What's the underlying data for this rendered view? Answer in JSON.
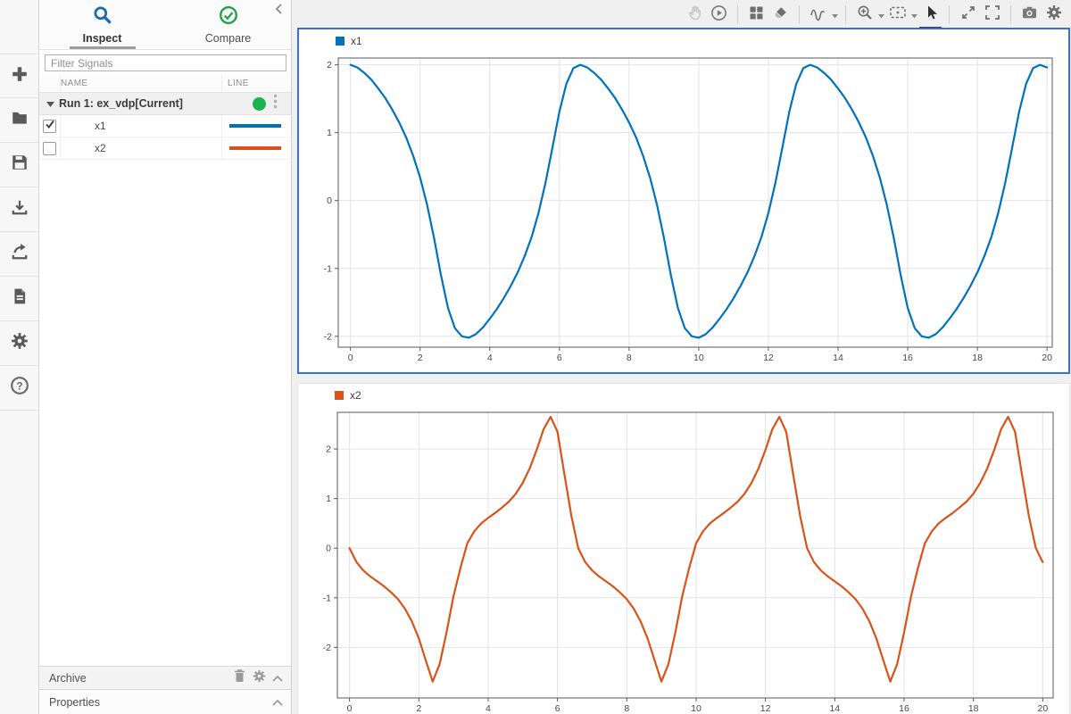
{
  "left_toolbar": {
    "items": [
      "add-icon",
      "open-folder-icon",
      "save-icon",
      "import-icon",
      "export-icon",
      "report-icon",
      "settings-icon",
      "help-icon"
    ]
  },
  "sidebar": {
    "collapse_icon": "chevron-left-icon",
    "tabs": [
      {
        "label": "Inspect",
        "icon": "magnifier-icon",
        "active": true
      },
      {
        "label": "Compare",
        "icon": "check-circle-icon",
        "active": false
      }
    ],
    "filter": {
      "placeholder": "Filter Signals"
    },
    "table": {
      "columns": [
        "NAME",
        "LINE"
      ],
      "run": {
        "label": "Run 1: ex_vdp[Current]",
        "status_color": "#1cb24c",
        "expanded": true,
        "menu_icon": "kebab-menu-icon"
      },
      "signals": [
        {
          "name": "x1",
          "checked": true,
          "color": "#0072BD"
        },
        {
          "name": "x2",
          "checked": false,
          "color": "#D95319"
        }
      ]
    },
    "archive": {
      "label": "Archive",
      "icons": [
        "trash-icon",
        "gear-icon",
        "chevron-up-icon"
      ]
    },
    "properties": {
      "label": "Properties",
      "icons": [
        "chevron-up-icon"
      ]
    }
  },
  "toolbar": {
    "groups": [
      [
        "pan-hand-icon",
        "replay-icon"
      ],
      [
        "layout-grid-icon",
        "eraser-icon"
      ],
      [
        "signal-wave-icon"
      ],
      [
        "zoom-in-icon",
        "zoom-fit-icon",
        "arrow-cursor-icon"
      ],
      [
        "expand-diagonal-icon",
        "fit-screen-icon"
      ],
      [
        "camera-icon",
        "gear-icon"
      ]
    ],
    "dropdowns": [
      "signal-wave-icon",
      "zoom-in-icon",
      "zoom-fit-icon"
    ],
    "active_tool": "arrow-cursor-icon",
    "disabled_tool": "pan-hand-icon"
  },
  "chart_data": [
    {
      "type": "line",
      "title": "x1",
      "legend": {
        "label": "x1",
        "color": "#0072BD"
      },
      "xlabel": "",
      "ylabel": "",
      "x_start": 0,
      "x_step": 0.2,
      "xlim": [
        -0.35,
        20.15
      ],
      "ylim": [
        -2.16,
        2.1
      ],
      "xticks": [
        0,
        2,
        4,
        6,
        8,
        10,
        12,
        14,
        16,
        18,
        20
      ],
      "yticks": [
        -2,
        -1,
        0,
        1,
        2
      ],
      "grid": true,
      "selected": true,
      "legend_position": "top-left",
      "values": [
        2,
        1.96,
        1.88,
        1.78,
        1.65,
        1.51,
        1.34,
        1.15,
        0.93,
        0.66,
        0.34,
        -0.06,
        -0.55,
        -1.1,
        -1.58,
        -1.88,
        -2,
        -2.02,
        -1.97,
        -1.87,
        -1.74,
        -1.6,
        -1.44,
        -1.26,
        -1.06,
        -0.82,
        -0.54,
        -0.18,
        0.26,
        0.78,
        1.31,
        1.72,
        1.95,
        2,
        1.96,
        1.88,
        1.78,
        1.65,
        1.51,
        1.34,
        1.15,
        0.93,
        0.66,
        0.34,
        -0.06,
        -0.55,
        -1.1,
        -1.58,
        -1.88,
        -2,
        -2.02,
        -1.97,
        -1.87,
        -1.74,
        -1.6,
        -1.44,
        -1.26,
        -1.06,
        -0.82,
        -0.54,
        -0.18,
        0.26,
        0.78,
        1.31,
        1.72,
        1.95,
        2,
        1.96,
        1.88,
        1.78,
        1.65,
        1.51,
        1.34,
        1.15,
        0.93,
        0.66,
        0.34,
        -0.06,
        -0.55,
        -1.1,
        -1.58,
        -1.88,
        -2,
        -2.02,
        -1.97,
        -1.87,
        -1.74,
        -1.6,
        -1.44,
        -1.26,
        -1.06,
        -0.82,
        -0.54,
        -0.18,
        0.26,
        0.78,
        1.31,
        1.72,
        1.95,
        2,
        1.96
      ]
    },
    {
      "type": "line",
      "title": "x2",
      "legend": {
        "label": "x2",
        "color": "#D95319"
      },
      "xlabel": "",
      "ylabel": "",
      "x_start": 0,
      "x_step": 0.2,
      "xlim": [
        -0.35,
        20.3
      ],
      "ylim": [
        -3.02,
        2.74
      ],
      "xticks": [
        0,
        2,
        4,
        6,
        8,
        10,
        12,
        14,
        16,
        18,
        20
      ],
      "yticks": [
        -2,
        -1,
        0,
        1,
        2
      ],
      "grid": true,
      "selected": false,
      "legend_position": "top-left",
      "values": [
        0,
        -0.28,
        -0.45,
        -0.57,
        -0.67,
        -0.77,
        -0.89,
        -1.03,
        -1.22,
        -1.48,
        -1.82,
        -2.26,
        -2.69,
        -2.34,
        -1.7,
        -0.97,
        -0.4,
        0.1,
        0.34,
        0.5,
        0.61,
        0.71,
        0.82,
        0.94,
        1.1,
        1.32,
        1.61,
        1.98,
        2.4,
        2.65,
        2.35,
        1.49,
        0.65,
        0,
        -0.28,
        -0.45,
        -0.57,
        -0.67,
        -0.77,
        -0.89,
        -1.03,
        -1.22,
        -1.48,
        -1.82,
        -2.26,
        -2.69,
        -2.34,
        -1.7,
        -0.97,
        -0.4,
        0.1,
        0.34,
        0.5,
        0.61,
        0.71,
        0.82,
        0.94,
        1.1,
        1.32,
        1.61,
        1.98,
        2.4,
        2.65,
        2.35,
        1.49,
        0.65,
        0,
        -0.28,
        -0.45,
        -0.57,
        -0.67,
        -0.77,
        -0.89,
        -1.03,
        -1.22,
        -1.48,
        -1.82,
        -2.26,
        -2.69,
        -2.34,
        -1.7,
        -0.97,
        -0.4,
        0.1,
        0.34,
        0.5,
        0.61,
        0.71,
        0.82,
        0.94,
        1.1,
        1.32,
        1.61,
        1.98,
        2.4,
        2.65,
        2.35,
        1.49,
        0.65,
        0,
        -0.28
      ]
    }
  ],
  "style": {
    "accent_blue": "#366fdb",
    "grid_color": "#e3e3e3",
    "axis_color": "#595959",
    "tick_label_color": "#474747"
  }
}
